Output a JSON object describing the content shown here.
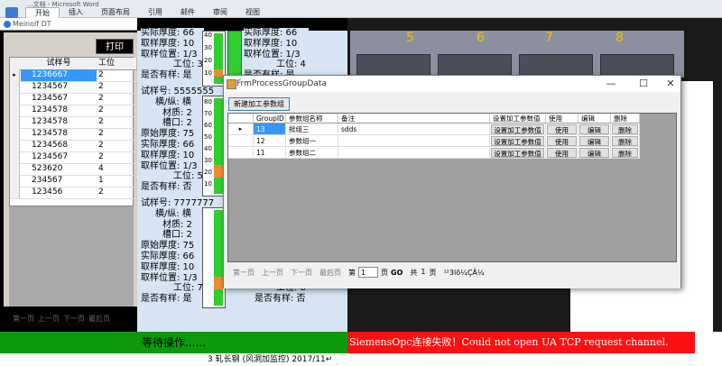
{
  "word": {
    "caption": "...文档 - Microsoft Word",
    "tabs": [
      "开始",
      "插入",
      "页面布局",
      "引用",
      "邮件",
      "审阅",
      "视图"
    ],
    "footer_text": "3 轧长钢 (风洞加监控) 2017/11↵"
  },
  "app": {
    "title": "Meinolf DT",
    "print_label": "打印",
    "table_headers": [
      "试样号",
      "工位"
    ],
    "rows": [
      {
        "id": "1236667",
        "pos": "2"
      },
      {
        "id": "1234567",
        "pos": "2"
      },
      {
        "id": "1234567",
        "pos": "2"
      },
      {
        "id": "1234578",
        "pos": "2"
      },
      {
        "id": "1234578",
        "pos": "2"
      },
      {
        "id": "1234578",
        "pos": "2"
      },
      {
        "id": "1234568",
        "pos": "2"
      },
      {
        "id": "1234567",
        "pos": "2"
      },
      {
        "id": "523620",
        "pos": "4"
      },
      {
        "id": "234567",
        "pos": "1"
      },
      {
        "id": "123456",
        "pos": "2"
      }
    ],
    "pager": [
      "第一页",
      "上一页",
      "下一页",
      "最后页"
    ],
    "status_ready": "等待操作......",
    "status_error": "SiemensOpc连接失败！Could not open UA TCP request channel."
  },
  "samples": {
    "top": [
      "实际厚度: 66",
      "取样厚度: 10",
      "取样位置: 1/3",
      "工位: 3",
      "是否有样: 是"
    ],
    "top_right": [
      "实际厚度: 66",
      "取样厚度: 10",
      "取样位置: 1/3",
      "工位: 4",
      "是否有样: 是"
    ],
    "middle": [
      "试样号: 5555555",
      "横/纵: 横",
      "材质: 2",
      "槽口: 2",
      "原始厚度: 75",
      "实际厚度: 66",
      "取样厚度: 10",
      "取样位置: 1/3",
      "工位: 5",
      "是否有样: 否"
    ],
    "bottom": [
      "试样号: 7777777",
      "横/纵: 横",
      "材质: 2",
      "槽口: 2",
      "原始厚度: 75",
      "实际厚度: 66",
      "取样厚度: 10",
      "取样位置: 1/3",
      "工位: 7",
      "是否有样: 是"
    ],
    "bottom_right_tail": [
      "工位: 8",
      "是否有样: 否"
    ],
    "gauge_labels": [
      "40",
      "30",
      "20",
      "10"
    ],
    "gauge_labels_mid": [
      "80",
      "70",
      "60",
      "50",
      "40",
      "30",
      "20",
      "10"
    ]
  },
  "machine": {
    "roll_numbers": [
      "5",
      "6",
      "7",
      "8"
    ]
  },
  "dialog": {
    "title": "FrmProcessGroupData",
    "new_button": "新建加工参数组",
    "headers": [
      "GroupID",
      "参数组名称",
      "备注",
      "设置加工参数值",
      "使用",
      "编辑",
      "删除"
    ],
    "rows": [
      {
        "id": "13",
        "name": "批组三",
        "note": "sdds"
      },
      {
        "id": "12",
        "name": "参数组一",
        "note": ""
      },
      {
        "id": "11",
        "name": "参数组二",
        "note": ""
      }
    ],
    "row_buttons": {
      "set": "设置加工参数值",
      "use": "使用",
      "edit": "编辑",
      "delete": "删除"
    },
    "pager": {
      "first": "第一页",
      "prev": "上一页",
      "next": "下一页",
      "last": "最后页",
      "page_prefix": "第",
      "page_value": "1",
      "page_suffix": "页",
      "go": "GO",
      "total_prefix": "共",
      "total_value": "1",
      "total_suffix": "页",
      "garbled": "¹²3lõ¼ÇÂ¼"
    }
  }
}
